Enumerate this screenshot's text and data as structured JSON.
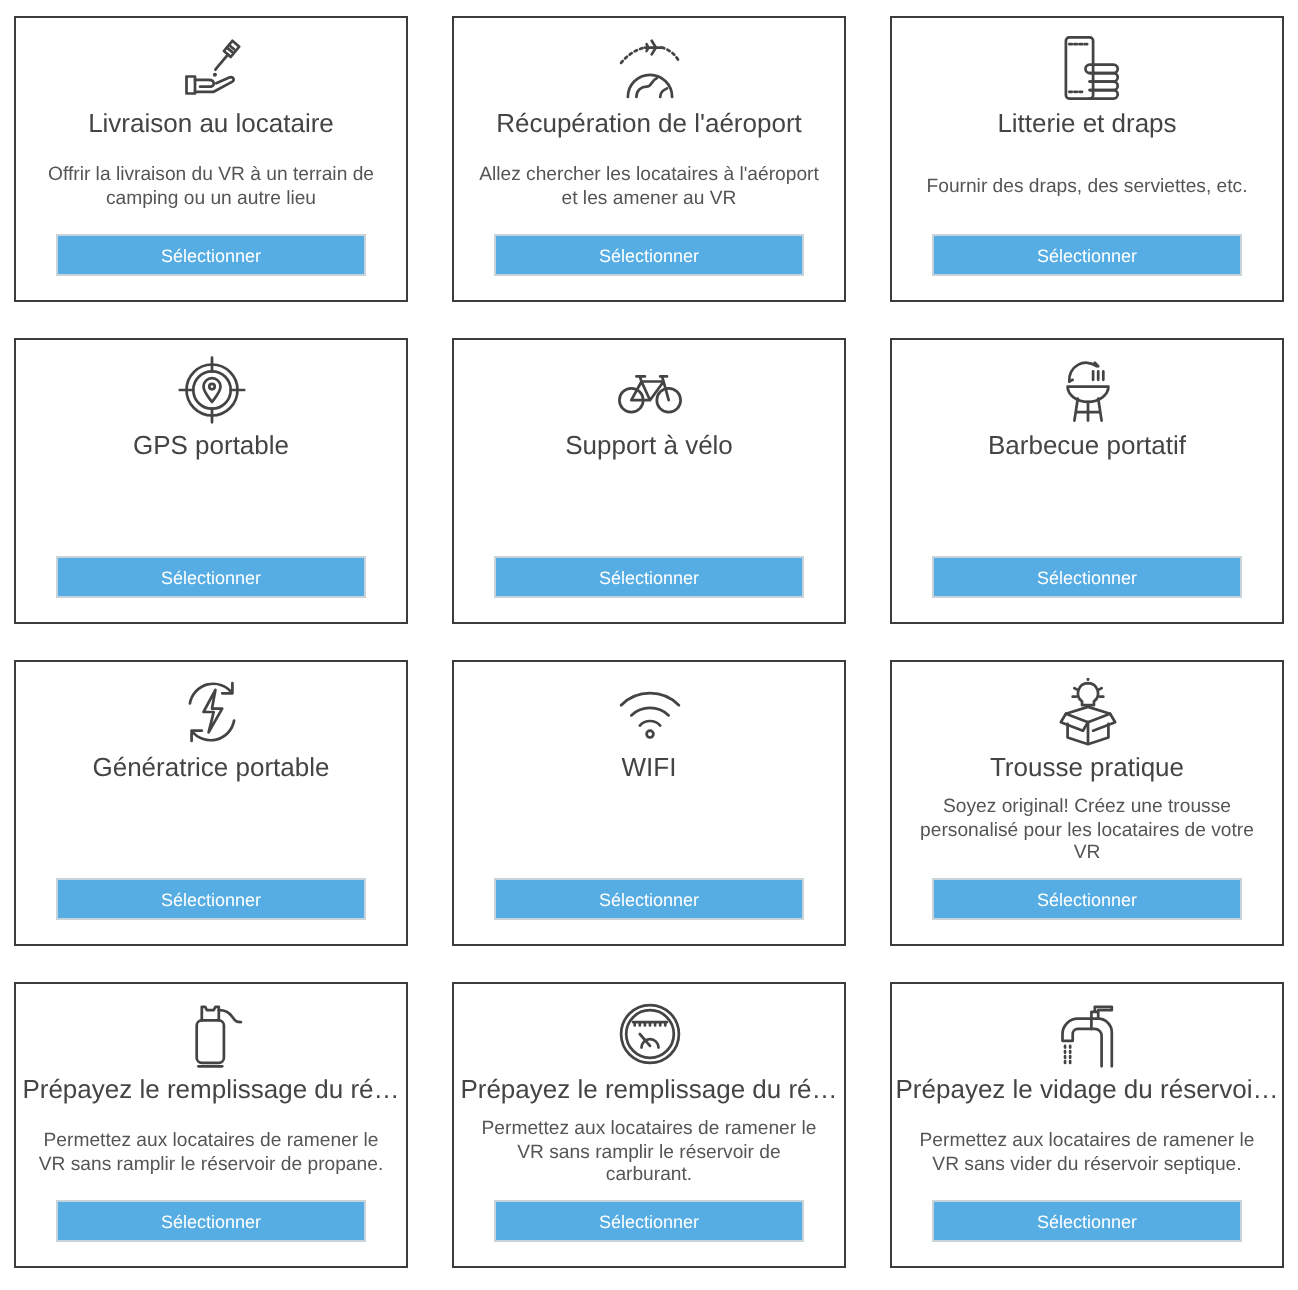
{
  "cards": [
    {
      "title": "Livraison au locataire",
      "description": "Offrir la livraison du VR à un terrain de camping ou un autre lieu",
      "button": "Sélectionner"
    },
    {
      "title": "Récupération de l'aéroport",
      "description": "Allez chercher les locataires à l'aéroport et les amener au VR",
      "button": "Sélectionner"
    },
    {
      "title": "Litterie et draps",
      "description": "Fournir des draps, des serviettes, etc.",
      "button": "Sélectionner"
    },
    {
      "title": "GPS portable",
      "button": "Sélectionner"
    },
    {
      "title": "Support à vélo",
      "button": "Sélectionner"
    },
    {
      "title": "Barbecue portatif",
      "button": "Sélectionner"
    },
    {
      "title": "Génératrice portable",
      "button": "Sélectionner"
    },
    {
      "title": "WIFI",
      "button": "Sélectionner"
    },
    {
      "title": "Trousse pratique",
      "description": "Soyez original! Créez une trousse personalisé pour les locataires de votre VR",
      "button": "Sélectionner"
    },
    {
      "title": "Prépayez le remplissage du ré…",
      "description": "Permettez aux locataires de ramener le VR sans ramplir le réservoir de propane.",
      "button": "Sélectionner"
    },
    {
      "title": "Prépayez le remplissage du ré…",
      "description": "Permettez aux locataires de ramener le VR sans ramplir le réservoir de carburant.",
      "button": "Sélectionner"
    },
    {
      "title": "Prépayez le vidage du réservoi…",
      "description": "Permettez aux locataires de ramener le VR sans vider du réservoir septique.",
      "button": "Sélectionner"
    }
  ]
}
